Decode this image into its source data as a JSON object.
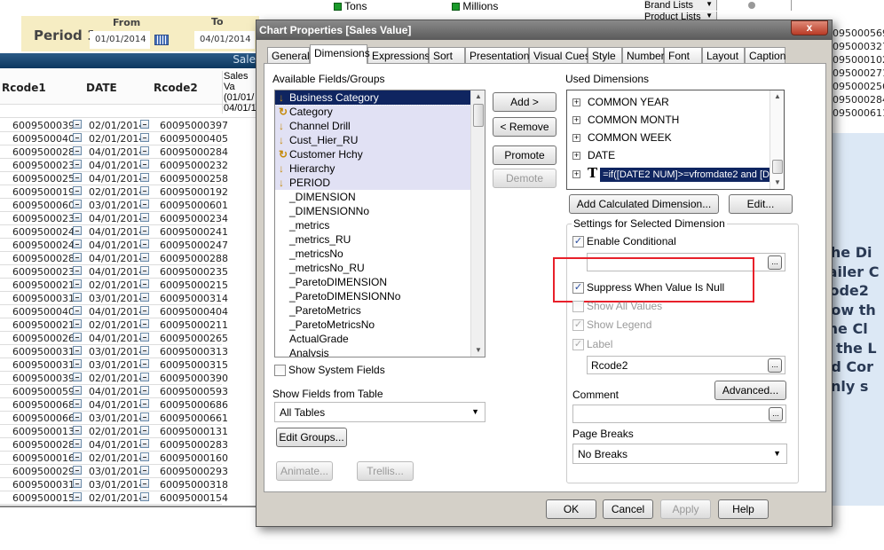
{
  "top_checks": [
    {
      "label": "Tons"
    },
    {
      "label": "Millions"
    }
  ],
  "top_lists": [
    {
      "label": "Brand Lists"
    },
    {
      "label": "Product Lists"
    }
  ],
  "period": {
    "label": "Period 1",
    "from_label": "From",
    "to_label": "To",
    "from_value": "01/01/2014",
    "to_value": "04/01/2014"
  },
  "table": {
    "title": "Sale",
    "headers": [
      "Rcode1",
      "DATE",
      "Rcode2",
      "Sales Va (01/01/ 04/01/1"
    ],
    "rows": [
      [
        "60095000397",
        "02/01/2014",
        "60095000397"
      ],
      [
        "60095000405",
        "02/01/2014",
        "60095000405"
      ],
      [
        "60095000284",
        "04/01/2014",
        "60095000284"
      ],
      [
        "60095000232",
        "04/01/2014",
        "60095000232"
      ],
      [
        "60095000258",
        "04/01/2014",
        "60095000258"
      ],
      [
        "60095000192",
        "02/01/2014",
        "60095000192"
      ],
      [
        "60095000601",
        "03/01/2014",
        "60095000601"
      ],
      [
        "60095000234",
        "04/01/2014",
        "60095000234"
      ],
      [
        "60095000241",
        "04/01/2014",
        "60095000241"
      ],
      [
        "60095000247",
        "04/01/2014",
        "60095000247"
      ],
      [
        "60095000288",
        "04/01/2014",
        "60095000288"
      ],
      [
        "60095000235",
        "04/01/2014",
        "60095000235"
      ],
      [
        "60095000215",
        "02/01/2014",
        "60095000215"
      ],
      [
        "60095000314",
        "03/01/2014",
        "60095000314"
      ],
      [
        "60095000404",
        "04/01/2014",
        "60095000404"
      ],
      [
        "60095000211",
        "02/01/2014",
        "60095000211"
      ],
      [
        "60095000265",
        "04/01/2014",
        "60095000265"
      ],
      [
        "60095000313",
        "03/01/2014",
        "60095000313"
      ],
      [
        "60095000315",
        "03/01/2014",
        "60095000315"
      ],
      [
        "60095000390",
        "02/01/2014",
        "60095000390"
      ],
      [
        "60095000593",
        "04/01/2014",
        "60095000593"
      ],
      [
        "60095000686",
        "04/01/2014",
        "60095000686"
      ],
      [
        "60095000661",
        "03/01/2014",
        "60095000661"
      ],
      [
        "60095000131",
        "02/01/2014",
        "60095000131"
      ],
      [
        "60095000283",
        "04/01/2014",
        "60095000283"
      ],
      [
        "60095000160",
        "02/01/2014",
        "60095000160"
      ],
      [
        "60095000293",
        "03/01/2014",
        "60095000293"
      ],
      [
        "60095000318",
        "03/01/2014",
        "60095000318"
      ],
      [
        "60095000154",
        "02/01/2014",
        "60095000154"
      ]
    ]
  },
  "right_numbers": [
    "095000569",
    "095000327",
    "095000102",
    "095000271",
    "095000256",
    "095000284",
    "095000611"
  ],
  "right_text": [
    "The Di",
    "tailer C",
    "code2",
    "how th",
    "the Cl",
    "n the L",
    "nd Cor",
    "only s"
  ],
  "dialog": {
    "title": "Chart Properties [Sales Value]",
    "close": "x",
    "tabs": [
      "General",
      "Dimensions",
      "Expressions",
      "Sort",
      "Presentation",
      "Visual Cues",
      "Style",
      "Number",
      "Font",
      "Layout",
      "Caption"
    ],
    "active_tab": "Dimensions",
    "available_label": "Available Fields/Groups",
    "available": [
      {
        "label": "Business Category",
        "icon": "drill-down-icon",
        "group": true
      },
      {
        "label": "Category",
        "icon": "cyclic-group-icon",
        "group": true
      },
      {
        "label": "Channel Drill",
        "icon": "drill-down-icon",
        "group": true
      },
      {
        "label": "Cust_Hier_RU",
        "icon": "drill-down-icon",
        "group": true
      },
      {
        "label": "Customer Hchy",
        "icon": "cyclic-group-icon",
        "group": true
      },
      {
        "label": "Hierarchy",
        "icon": "drill-down-icon",
        "group": true
      },
      {
        "label": "PERIOD",
        "icon": "drill-down-icon",
        "group": true
      },
      {
        "label": "_DIMENSION"
      },
      {
        "label": "_DIMENSIONNo"
      },
      {
        "label": "_metrics"
      },
      {
        "label": "_metrics_RU"
      },
      {
        "label": "_metricsNo"
      },
      {
        "label": "_metricsNo_RU"
      },
      {
        "label": "_ParetoDIMENSION"
      },
      {
        "label": "_ParetoDIMENSIONNo"
      },
      {
        "label": "_ParetoMetrics"
      },
      {
        "label": "_ParetoMetricsNo"
      },
      {
        "label": "ActualGrade"
      },
      {
        "label": "Analysis"
      }
    ],
    "show_system_fields": "Show System Fields",
    "show_fields_from_table_label": "Show Fields from Table",
    "show_fields_from_table_value": "All Tables",
    "edit_groups": "Edit Groups...",
    "animate": "Animate...",
    "trellis": "Trellis...",
    "add": "Add >",
    "remove": "< Remove",
    "promote": "Promote",
    "demote": "Demote",
    "used_label": "Used Dimensions",
    "used": [
      {
        "label": "COMMON YEAR"
      },
      {
        "label": "COMMON MONTH"
      },
      {
        "label": "COMMON WEEK"
      },
      {
        "label": "DATE"
      },
      {
        "label": "=if([DATE2 NUM]>=vfromdate2 and [DATE",
        "calculated": true,
        "selected": true
      }
    ],
    "add_calc": "Add Calculated Dimension...",
    "edit": "Edit...",
    "settings_label": "Settings for Selected Dimension",
    "enable_conditional": {
      "label": "Enable Conditional",
      "checked": true
    },
    "conditional_value": "",
    "suppress_null": {
      "label": "Suppress When Value Is Null",
      "checked": true
    },
    "show_all_values": {
      "label": "Show All Values",
      "checked": false
    },
    "show_legend": {
      "label": "Show Legend",
      "checked": true
    },
    "label_check": {
      "label": "Label",
      "checked": true
    },
    "label_value": "Rcode2",
    "advanced": "Advanced...",
    "comment_label": "Comment",
    "comment_value": "",
    "page_breaks_label": "Page Breaks",
    "page_breaks_value": "No Breaks",
    "ellipsis": "...",
    "ok": "OK",
    "cancel": "Cancel",
    "apply": "Apply",
    "help": "Help",
    "highlight_color": "#e8202a"
  }
}
